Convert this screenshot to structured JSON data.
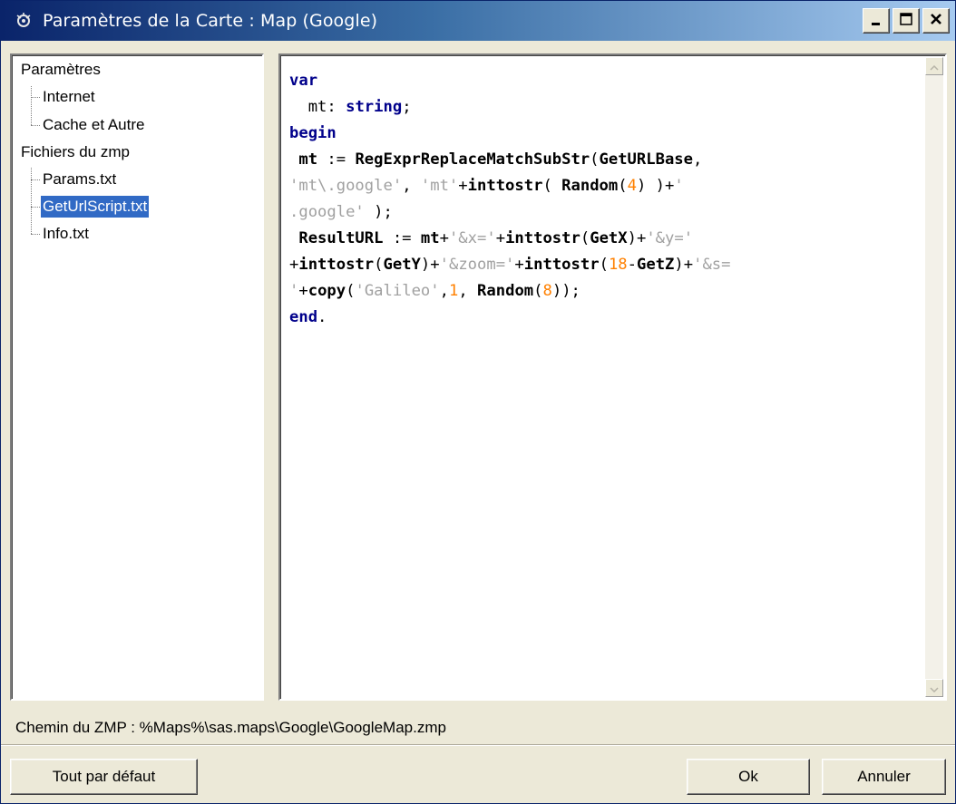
{
  "window": {
    "title": "Paramètres de la Carte : Map (Google)",
    "buttons": {
      "minimize": "minimize-icon",
      "maximize": "maximize-icon",
      "close": "close-icon"
    }
  },
  "tree": {
    "items": [
      {
        "label": "Paramètres",
        "level": 0
      },
      {
        "label": "Internet",
        "level": 1
      },
      {
        "label": "Cache et Autre",
        "level": 1
      },
      {
        "label": "Fichiers du zmp",
        "level": 0
      },
      {
        "label": "Params.txt",
        "level": 1
      },
      {
        "label": "GetUrlScript.txt",
        "level": 1,
        "selected": true
      },
      {
        "label": "Info.txt",
        "level": 1
      }
    ]
  },
  "editor": {
    "lines": [
      [
        [
          "kw",
          "var"
        ]
      ],
      [
        [
          "",
          "  mt: "
        ],
        [
          "kw",
          "string"
        ],
        [
          "",
          ";"
        ]
      ],
      [
        [
          "kw",
          "begin"
        ]
      ],
      [
        [
          "ident",
          " mt"
        ],
        [
          "",
          " := "
        ],
        [
          "ident",
          "RegExprReplaceMatchSubStr"
        ],
        [
          "",
          "("
        ],
        [
          "ident",
          "GetURLBase"
        ],
        [
          "",
          ","
        ]
      ],
      [
        [
          "str",
          "'mt\\.google'"
        ],
        [
          "",
          ", "
        ],
        [
          "str",
          "'mt'"
        ],
        [
          "",
          "+"
        ],
        [
          "ident",
          "inttostr"
        ],
        [
          "",
          "( "
        ],
        [
          "ident",
          "Random"
        ],
        [
          "",
          "("
        ],
        [
          "num",
          "4"
        ],
        [
          "",
          ") )+"
        ],
        [
          "str",
          "'"
        ]
      ],
      [
        [
          "str",
          ".google'"
        ],
        [
          "",
          " );"
        ]
      ],
      [
        [
          "ident",
          " ResultURL"
        ],
        [
          "",
          " := "
        ],
        [
          "ident",
          "mt"
        ],
        [
          "",
          "+"
        ],
        [
          "str",
          "'&x='"
        ],
        [
          "",
          "+"
        ],
        [
          "ident",
          "inttostr"
        ],
        [
          "",
          "("
        ],
        [
          "ident",
          "GetX"
        ],
        [
          "",
          ")+"
        ],
        [
          "str",
          "'&y='"
        ]
      ],
      [
        [
          "",
          "+"
        ],
        [
          "ident",
          "inttostr"
        ],
        [
          "",
          "("
        ],
        [
          "ident",
          "GetY"
        ],
        [
          "",
          ")+"
        ],
        [
          "str",
          "'&zoom='"
        ],
        [
          "",
          "+"
        ],
        [
          "ident",
          "inttostr"
        ],
        [
          "",
          "("
        ],
        [
          "num",
          "18"
        ],
        [
          "",
          "-"
        ],
        [
          "ident",
          "GetZ"
        ],
        [
          "",
          ")+"
        ],
        [
          "str",
          "'&s="
        ]
      ],
      [
        [
          "str",
          "'"
        ],
        [
          "",
          "+"
        ],
        [
          "ident",
          "copy"
        ],
        [
          "",
          "("
        ],
        [
          "str",
          "'Galileo'"
        ],
        [
          "",
          ","
        ],
        [
          "num",
          "1"
        ],
        [
          "",
          ", "
        ],
        [
          "ident",
          "Random"
        ],
        [
          "",
          "("
        ],
        [
          "num",
          "8"
        ],
        [
          "",
          "));"
        ]
      ],
      [
        [
          "kw",
          "end"
        ],
        [
          "",
          "."
        ]
      ]
    ]
  },
  "status": {
    "path_label": "Chemin du ZMP :  %Maps%\\sas.maps\\Google\\GoogleMap.zmp"
  },
  "buttons": {
    "reset_label": "Tout par défaut",
    "ok_label": "Ok",
    "cancel_label": "Annuler"
  },
  "colors": {
    "titlebar": "#0a246a",
    "selection": "#316ac5",
    "keyword": "#00008b",
    "string": "#a0a0a0",
    "number": "#ff8000"
  }
}
